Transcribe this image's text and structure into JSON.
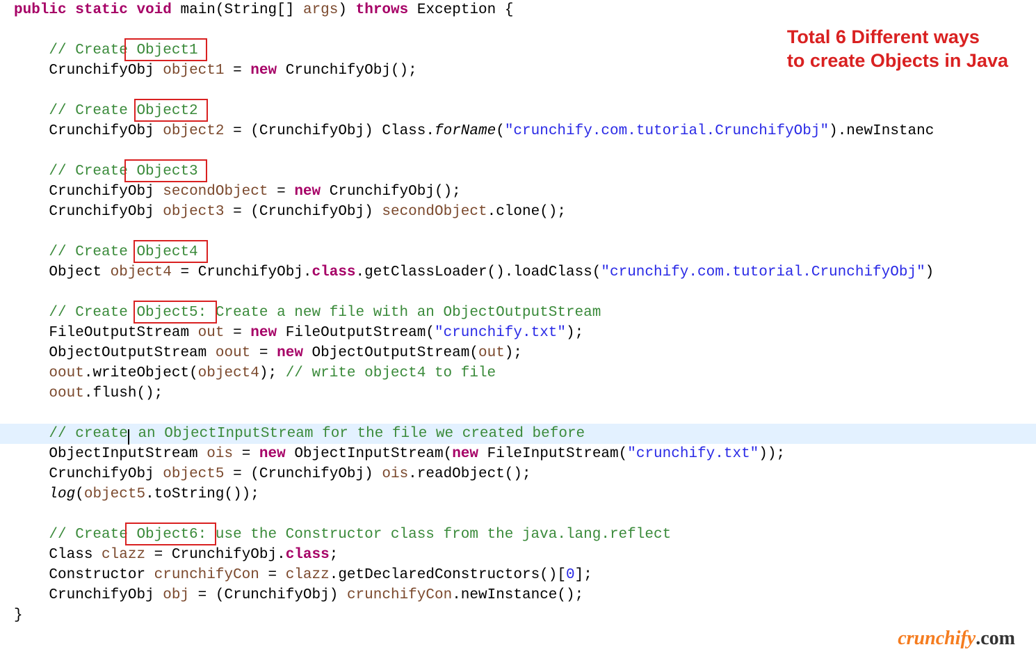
{
  "title": {
    "line1": "Total 6 Different ways",
    "line2": "to create Objects in Java"
  },
  "watermark": {
    "brand": "crunchify",
    "suffix": ".com"
  },
  "syntax": {
    "kw_public": "public",
    "kw_static": "static",
    "kw_void": "void",
    "kw_throws": "throws",
    "kw_new": "new",
    "kw_class": "class"
  },
  "code": {
    "sig_main": "main",
    "sig_args_type": "String[]",
    "sig_args_name": "args",
    "sig_exc": "Exception",
    "c1": "// Create Object1",
    "l1a_type": "CrunchifyObj",
    "l1a_var": "object1",
    "l1a_ctor": "CrunchifyObj",
    "c2": "// Create Object2",
    "l2_type": "CrunchifyObj",
    "l2_var": "object2",
    "l2_cast": "CrunchifyObj",
    "l2_class": "Class",
    "l2_forname": "forName",
    "l2_str": "\"crunchify.com.tutorial.CrunchifyObj\"",
    "l2_tail": ".newInstanc",
    "c3": "// Create Object3",
    "l3a_type": "CrunchifyObj",
    "l3a_var": "secondObject",
    "l3a_ctor": "CrunchifyObj",
    "l3b_type": "CrunchifyObj",
    "l3b_var": "object3",
    "l3b_cast": "CrunchifyObj",
    "l3b_src": "secondObject",
    "l3b_m": ".clone();",
    "c4": "// Create Object4",
    "l4_type": "Object",
    "l4_var": "object4",
    "l4_expr1": "CrunchifyObj.",
    "l4_expr2": ".getClassLoader().loadClass(",
    "l4_str": "\"crunchify.com.tutorial.CrunchifyObj\"",
    "l4_tail": ")",
    "c5": "// Create Object5: Create a new file with an ObjectOutputStream",
    "l5a_type": "FileOutputStream",
    "l5a_var": "out",
    "l5a_ctor": "FileOutputStream",
    "l5a_str": "\"crunchify.txt\"",
    "l5b_type": "ObjectOutputStream",
    "l5b_var": "oout",
    "l5b_ctor": "ObjectOutputStream",
    "l5b_arg": "out",
    "l5c_obj": "oout",
    "l5c_m": ".writeObject(",
    "l5c_arg": "object4",
    "l5c_cmt": "// write object4 to file",
    "l5d_obj": "oout",
    "l5d_m": ".flush();",
    "c_ois": "// create an ObjectInputStream for the file we created before",
    "l6a_type": "ObjectInputStream",
    "l6a_var": "ois",
    "l6a_ctor1": "ObjectInputStream",
    "l6a_ctor2": "FileInputStream",
    "l6a_str": "\"crunchify.txt\"",
    "l6b_type": "CrunchifyObj",
    "l6b_var": "object5",
    "l6b_cast": "CrunchifyObj",
    "l6b_src": "ois",
    "l6b_m": ".readObject();",
    "l6c_log": "log",
    "l6c_arg": "object5",
    "l6c_m": ".toString());",
    "c6": "// Create Object6: use the Constructor class from the java.lang.reflect",
    "l7a_type": "Class",
    "l7a_var": "clazz",
    "l7a_expr": "CrunchifyObj.",
    "l7b_type": "Constructor",
    "l7b_var": "crunchifyCon",
    "l7b_src": "clazz",
    "l7b_m": ".getDeclaredConstructors()[",
    "l7b_idx": "0",
    "l7c_type": "CrunchifyObj",
    "l7c_var": "obj",
    "l7c_cast": "CrunchifyObj",
    "l7c_src": "crunchifyCon",
    "l7c_m": ".newInstance();",
    "brace_close": "}"
  }
}
